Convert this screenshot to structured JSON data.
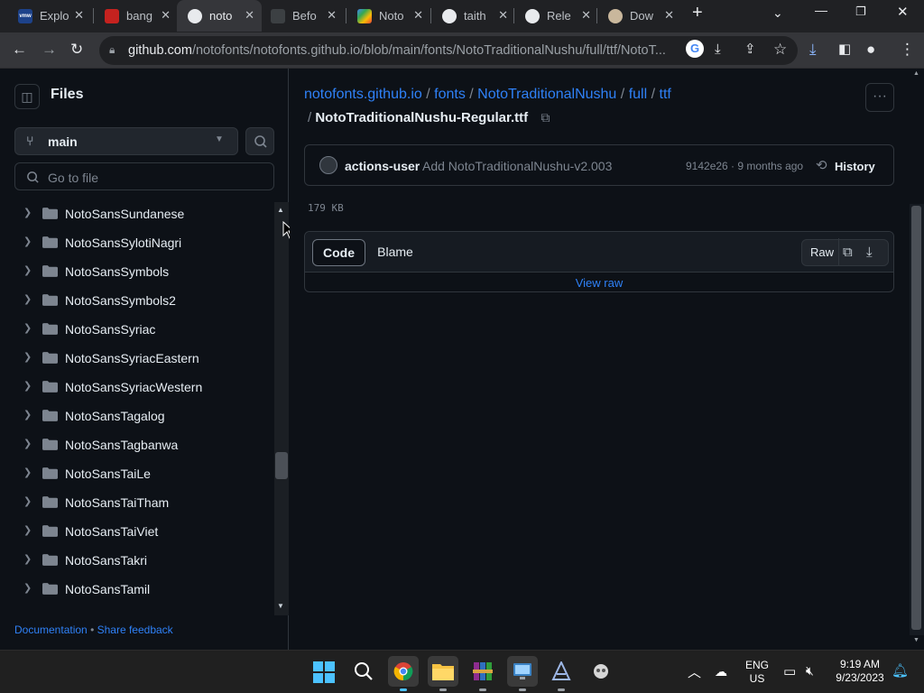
{
  "browser": {
    "tabs": [
      {
        "label": "Explo",
        "favicon": "vmw-icon",
        "color": "#1d428a"
      },
      {
        "label": "bang",
        "favicon": "pdf-icon",
        "color": "#c5221f"
      },
      {
        "label": "noto",
        "favicon": "github-icon",
        "color": "#e8eaed",
        "active": true
      },
      {
        "label": "Befo",
        "favicon": "shield-icon",
        "color": "#3c4043"
      },
      {
        "label": "Noto",
        "favicon": "google-fonts-icon",
        "color": "#34a853"
      },
      {
        "label": "taith",
        "favicon": "github-icon",
        "color": "#e8eaed"
      },
      {
        "label": "Rele",
        "favicon": "github-icon",
        "color": "#e8eaed"
      },
      {
        "label": "Dow",
        "favicon": "download-site-icon",
        "color": "#c9b79c"
      }
    ],
    "url_host": "github.com",
    "url_path": "/notofonts/notofonts.github.io/blob/main/fonts/NotoTraditionalNushu/full/ttf/NotoT..."
  },
  "sidebar": {
    "title": "Files",
    "branch": "main",
    "go_to_file_placeholder": "Go to file",
    "items": [
      {
        "label": "NotoSansSundanese"
      },
      {
        "label": "NotoSansSylotiNagri"
      },
      {
        "label": "NotoSansSymbols"
      },
      {
        "label": "NotoSansSymbols2"
      },
      {
        "label": "NotoSansSyriac"
      },
      {
        "label": "NotoSansSyriacEastern"
      },
      {
        "label": "NotoSansSyriacWestern"
      },
      {
        "label": "NotoSansTagalog"
      },
      {
        "label": "NotoSansTagbanwa"
      },
      {
        "label": "NotoSansTaiLe"
      },
      {
        "label": "NotoSansTaiTham"
      },
      {
        "label": "NotoSansTaiViet"
      },
      {
        "label": "NotoSansTakri"
      },
      {
        "label": "NotoSansTamil"
      }
    ],
    "footer": {
      "documentation": "Documentation",
      "separator": "•",
      "feedback": "Share feedback"
    }
  },
  "main": {
    "breadcrumb": [
      "notofonts.github.io",
      "fonts",
      "NotoTraditionalNushu",
      "full",
      "ttf"
    ],
    "breadcrumb_sep": "/",
    "filename": "NotoTraditionalNushu-Regular.ttf",
    "commit": {
      "author": "actions-user",
      "message": "Add NotoTraditionalNushu-v2.003",
      "sha_time": "9142e26 · 9 months ago",
      "history": "History"
    },
    "file_size": "179 KB",
    "tabs": {
      "code": "Code",
      "blame": "Blame"
    },
    "raw": "Raw",
    "view_raw": "View raw"
  },
  "taskbar": {
    "lang_line1": "ENG",
    "lang_line2": "US",
    "time": "9:19 AM",
    "date": "9/23/2023"
  }
}
